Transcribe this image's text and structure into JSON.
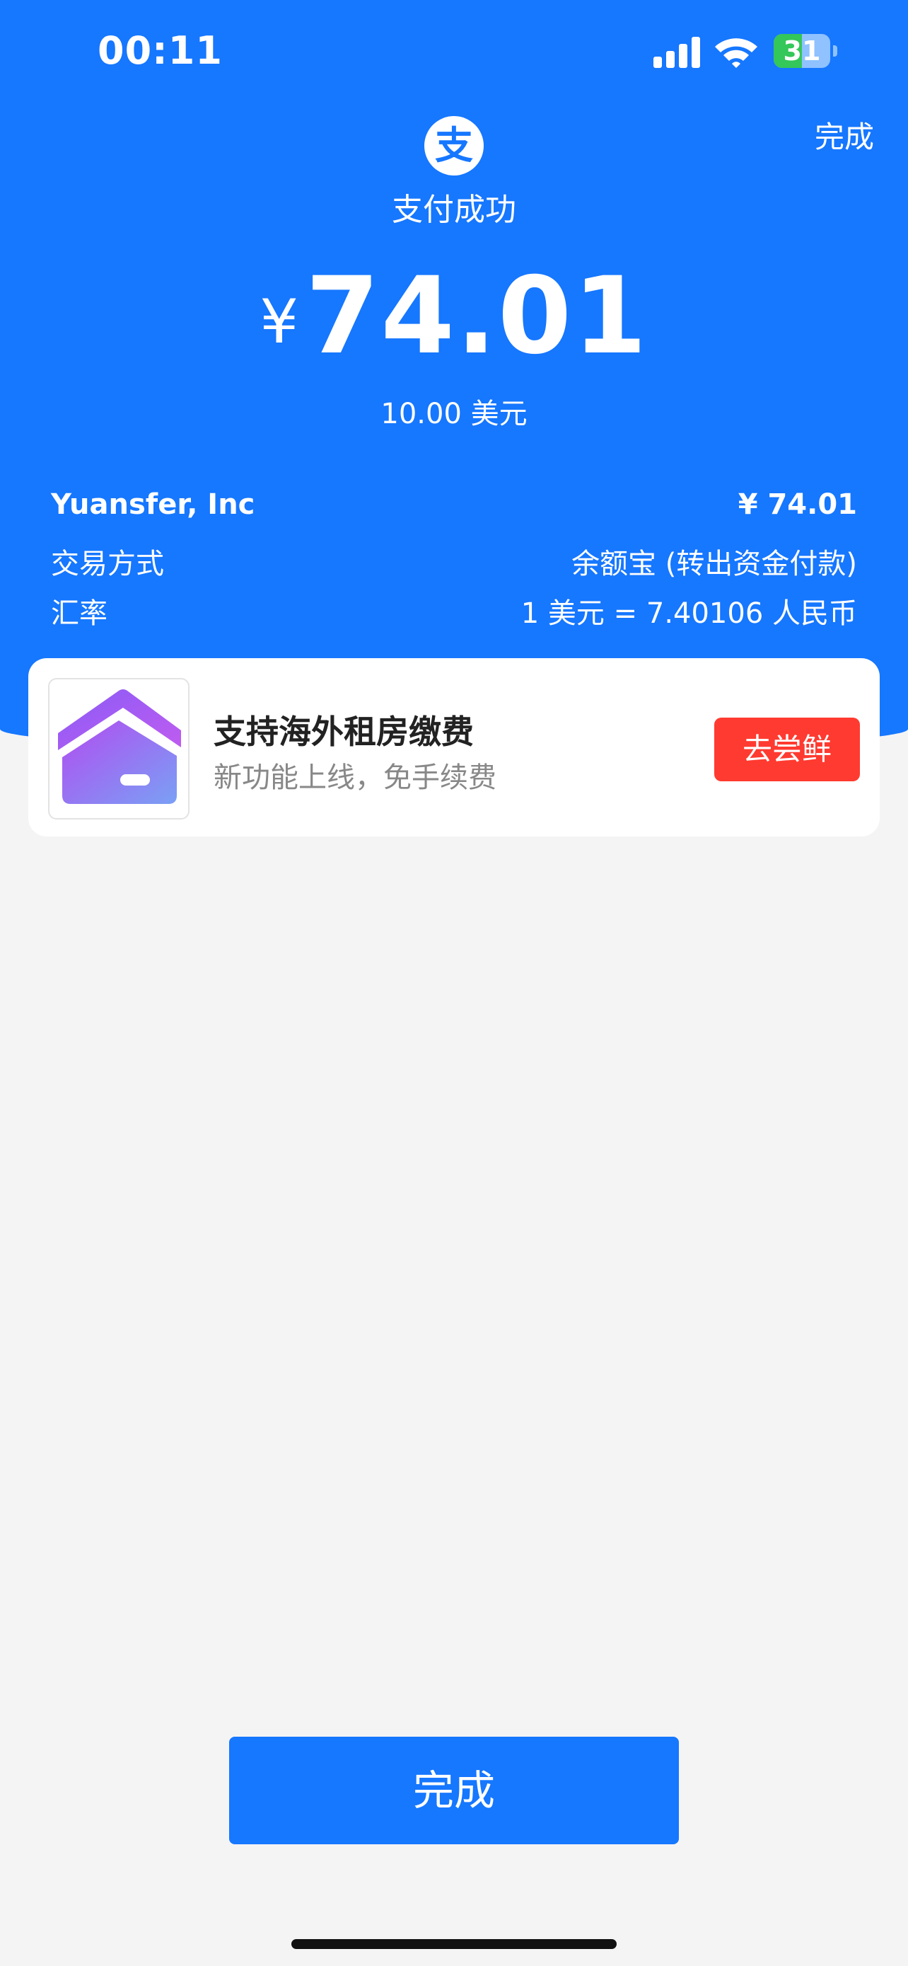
{
  "status_bar": {
    "time": "00:11",
    "battery_level": "31"
  },
  "header": {
    "done_label": "完成",
    "logo_char": "支",
    "status_text": "支付成功"
  },
  "amount": {
    "currency_symbol": "¥",
    "value": "74.01",
    "foreign_amount": "10.00 美元"
  },
  "details": [
    {
      "label": "Yuansfer, Inc",
      "value": "¥ 74.01"
    },
    {
      "label": "交易方式",
      "value": "余额宝 (转出资金付款)"
    },
    {
      "label": "汇率",
      "value": "1 美元 = 7.40106 人民币"
    }
  ],
  "promo": {
    "title": "支持海外租房缴费",
    "subtitle": "新功能上线，免手续费",
    "button_label": "去尝鲜",
    "icon": "house-icon"
  },
  "footer": {
    "done_button_label": "完成"
  },
  "colors": {
    "brand_blue": "#1677ff",
    "promo_red": "#ff3a30",
    "battery_green": "#34c759"
  }
}
